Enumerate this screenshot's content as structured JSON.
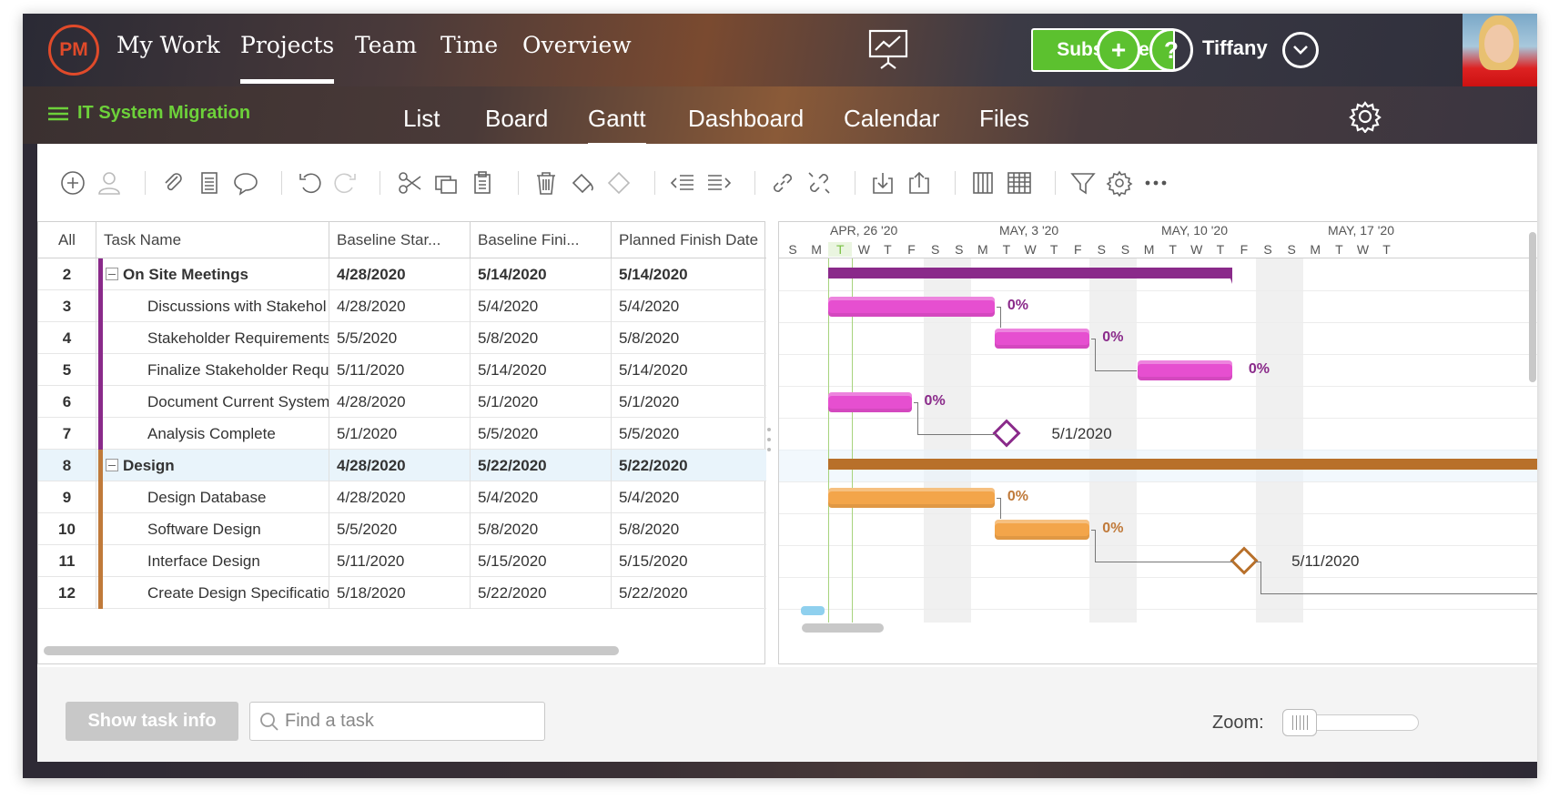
{
  "header": {
    "logo": "PM",
    "nav": [
      "My Work",
      "Projects",
      "Team",
      "Time",
      "Overview"
    ],
    "active_nav": "Projects",
    "subscribe": "Subscribe",
    "user": "Tiffany",
    "icons": [
      "presentation-icon",
      "add-circle-icon",
      "help-circle-icon",
      "chevron-down-icon",
      "gear-icon"
    ]
  },
  "project": {
    "title": "IT System Migration",
    "views": [
      "List",
      "Board",
      "Gantt",
      "Dashboard",
      "Calendar",
      "Files"
    ],
    "active_view": "Gantt"
  },
  "grid": {
    "columns": [
      "All",
      "Task Name",
      "Baseline Star...",
      "Baseline Fini...",
      "Planned Finish Date"
    ],
    "rows": [
      {
        "id": "2",
        "name": "On Site Meetings",
        "bstart": "4/28/2020",
        "bfinish": "5/14/2020",
        "pfinish": "5/14/2020",
        "summary": true,
        "color": "#8a2a8a"
      },
      {
        "id": "3",
        "name": "Discussions with Stakehol",
        "bstart": "4/28/2020",
        "bfinish": "5/4/2020",
        "pfinish": "5/4/2020",
        "summary": false,
        "color": "#8a2a8a"
      },
      {
        "id": "4",
        "name": "Stakeholder Requirements",
        "bstart": "5/5/2020",
        "bfinish": "5/8/2020",
        "pfinish": "5/8/2020",
        "summary": false,
        "color": "#8a2a8a"
      },
      {
        "id": "5",
        "name": "Finalize Stakeholder Requi",
        "bstart": "5/11/2020",
        "bfinish": "5/14/2020",
        "pfinish": "5/14/2020",
        "summary": false,
        "color": "#8a2a8a"
      },
      {
        "id": "6",
        "name": "Document Current System",
        "bstart": "4/28/2020",
        "bfinish": "5/1/2020",
        "pfinish": "5/1/2020",
        "summary": false,
        "color": "#8a2a8a"
      },
      {
        "id": "7",
        "name": "Analysis Complete",
        "bstart": "5/1/2020",
        "bfinish": "5/5/2020",
        "pfinish": "5/5/2020",
        "summary": false,
        "color": "#8a2a8a"
      },
      {
        "id": "8",
        "name": "Design",
        "bstart": "4/28/2020",
        "bfinish": "5/22/2020",
        "pfinish": "5/22/2020",
        "summary": true,
        "color": "#c07a3a"
      },
      {
        "id": "9",
        "name": "Design Database",
        "bstart": "4/28/2020",
        "bfinish": "5/4/2020",
        "pfinish": "5/4/2020",
        "summary": false,
        "color": "#c07a3a"
      },
      {
        "id": "10",
        "name": "Software Design",
        "bstart": "5/5/2020",
        "bfinish": "5/8/2020",
        "pfinish": "5/8/2020",
        "summary": false,
        "color": "#c07a3a"
      },
      {
        "id": "11",
        "name": "Interface Design",
        "bstart": "5/11/2020",
        "bfinish": "5/15/2020",
        "pfinish": "5/15/2020",
        "summary": false,
        "color": "#c07a3a"
      },
      {
        "id": "12",
        "name": "Create Design Specificatio",
        "bstart": "5/18/2020",
        "bfinish": "5/22/2020",
        "pfinish": "5/22/2020",
        "summary": false,
        "color": "#c07a3a"
      }
    ]
  },
  "gantt": {
    "months": [
      "APR, 26 '20",
      "MAY, 3 '20",
      "MAY, 10 '20",
      "MAY, 17 '20"
    ],
    "day_letters": [
      "S",
      "M",
      "T",
      "W",
      "T",
      "F",
      "S",
      "S",
      "M",
      "T",
      "W",
      "T",
      "F",
      "S",
      "S",
      "M",
      "T",
      "W",
      "T",
      "F",
      "S",
      "S",
      "M",
      "T",
      "W",
      "T"
    ],
    "today_letter_index": 2,
    "labels": {
      "p3": "0%",
      "p4": "0%",
      "p5": "0%",
      "p6": "0%",
      "m7": "5/1/2020",
      "p9": "0%",
      "p10": "0%",
      "m11": "5/11/2020"
    },
    "colors": {
      "purple_summary": "#8a2a8a",
      "pink_task": "#e64fd0",
      "orange_summary": "#b8702a",
      "orange_task": "#f3a54a",
      "pct_purple": "#8a2a8a",
      "pct_orange": "#c07a3a"
    }
  },
  "footer": {
    "show_task_info": "Show task info",
    "find_placeholder": "Find a task",
    "zoom_label": "Zoom:"
  }
}
